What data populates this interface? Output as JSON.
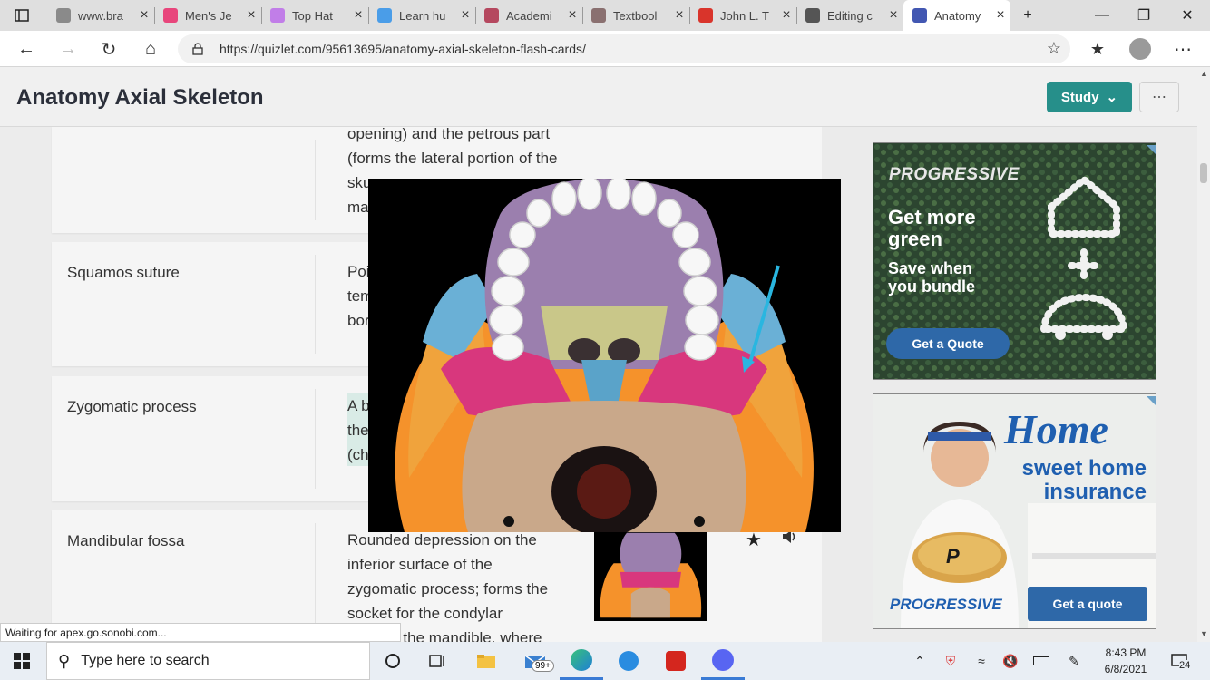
{
  "browser": {
    "tabs": [
      {
        "label": "www.bra",
        "color": "#8a8a8a"
      },
      {
        "label": "Men's Je",
        "color": "#e8467c"
      },
      {
        "label": "Top Hat",
        "color": "#c17ee8"
      },
      {
        "label": "Learn hu",
        "color": "#4a9de8"
      },
      {
        "label": "Academi",
        "color": "#b5485f"
      },
      {
        "label": "Textbool",
        "color": "#8a7070"
      },
      {
        "label": "John L. T",
        "color": "#d9342b"
      },
      {
        "label": "Editing c",
        "color": "#555"
      },
      {
        "label": "Anatomy",
        "color": "#4257b2"
      }
    ],
    "new_tab": "+",
    "url": "https://quizlet.com/95613695/anatomy-axial-skeleton-flash-cards/"
  },
  "page": {
    "title": "Anatomy Axial Skeleton",
    "study_label": "Study",
    "more_label": "⋯"
  },
  "cards": [
    {
      "term": "",
      "definition": "opening) and the petrous part\n(forms the lateral portion of the\nsku\nma"
    },
    {
      "term": "Squamos suture",
      "definition": "Poi\ntem\nbor"
    },
    {
      "term": "Zygomatic process",
      "definition": "A b\nthe\n(ch"
    },
    {
      "term": "Mandibular fossa",
      "definition": "Rounded depression on the\ninferior surface of the\nzygomatic process; forms the\nsocket for the condylar\n         of the mandible, where"
    }
  ],
  "ads": {
    "ad1": {
      "brand": "PROGRESSIVE",
      "headline": "Get more\ngreen",
      "sub": "Save when\nyou bundle",
      "cta": "Get a Quote"
    },
    "ad2": {
      "headline": "Home",
      "sub1": "sweet home",
      "sub2": "insurance",
      "brand": "PROGRESSIVE",
      "cta": "Get a quote",
      "pie_letter": "P"
    }
  },
  "status_text": "Waiting for apex.go.sonobi.com...",
  "taskbar": {
    "search_placeholder": "Type here to search",
    "mail_badge": "99+",
    "time": "8:43 PM",
    "date": "6/8/2021",
    "notification_count": "24"
  }
}
